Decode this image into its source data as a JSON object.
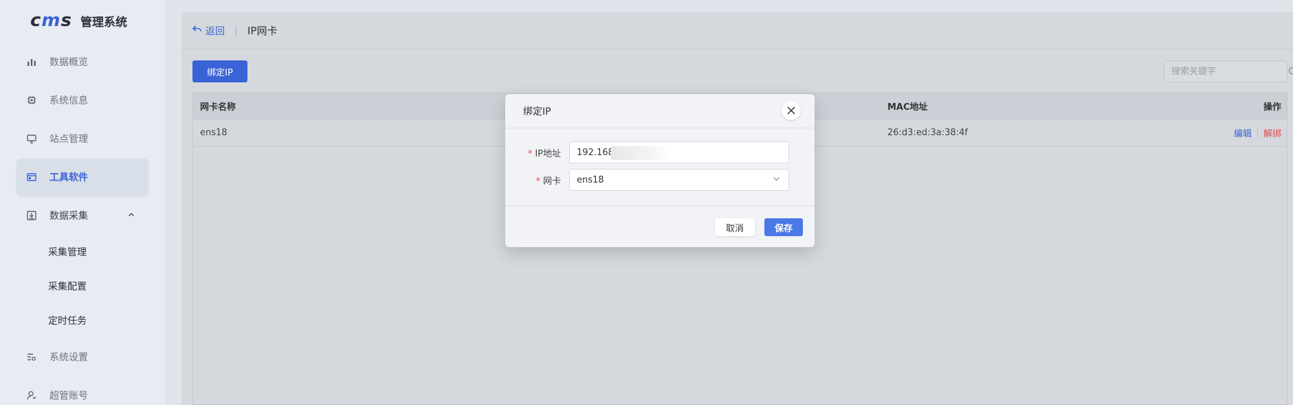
{
  "app": {
    "logo": "cms",
    "title": "管理系统"
  },
  "sidebar": {
    "items": [
      {
        "label": "数据概览",
        "icon": "bar-chart-icon"
      },
      {
        "label": "系统信息",
        "icon": "cpu-chip-icon"
      },
      {
        "label": "站点管理",
        "icon": "monitor-icon"
      },
      {
        "label": "工具软件",
        "icon": "window-icon",
        "active": true
      },
      {
        "label": "数据采集",
        "icon": "download-box-icon",
        "expanded": true
      },
      {
        "label": "系统设置",
        "icon": "settings-list-icon"
      },
      {
        "label": "超管账号",
        "icon": "user-icon"
      }
    ],
    "sub_items": [
      {
        "label": "采集管理"
      },
      {
        "label": "采集配置"
      },
      {
        "label": "定时任务"
      }
    ]
  },
  "header": {
    "back_label": "返回",
    "title": "IP网卡"
  },
  "toolbar": {
    "bind_label": "绑定IP",
    "search_placeholder": "搜索关键字"
  },
  "table": {
    "columns": [
      "网卡名称",
      "MAC地址",
      "操作"
    ],
    "rows": [
      {
        "name": "ens18",
        "mac": "26:d3:ed:3a:38:4f",
        "edit": "编辑",
        "unbind": "解绑"
      }
    ]
  },
  "dialog": {
    "title": "绑定IP",
    "ip_label": "IP地址",
    "ip_value": "192.168",
    "nic_label": "网卡",
    "nic_value": "ens18",
    "cancel_label": "取消",
    "save_label": "保存"
  },
  "colors": {
    "accent": "#3a63d8",
    "danger": "#e04a4a"
  }
}
